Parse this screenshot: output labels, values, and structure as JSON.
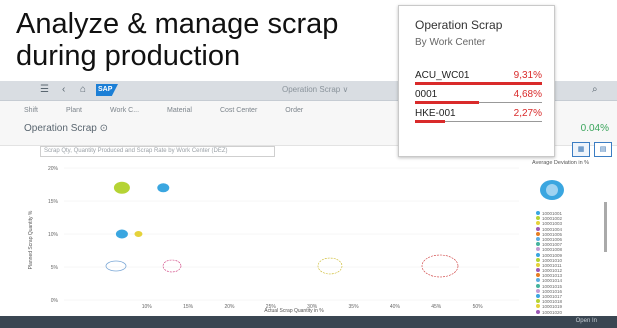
{
  "headline": {
    "line1": "Analyze & manage scrap",
    "line2": "during production"
  },
  "shellbar": {
    "title": "Operation Scrap ∨",
    "logo": "SAP"
  },
  "subheader": {
    "filters": [
      "Shift",
      "Plant",
      "Work C...",
      "Material",
      "Cost Center",
      "Order"
    ],
    "page_title": "Operation Scrap",
    "kpi": "0.04%"
  },
  "toolbar": {
    "crumb": "Scrap Qty, Quantity Produced and Scrap Rate by Work Center (DEZ)",
    "chart_btn": "▦",
    "table_btn": "▤"
  },
  "chart": {
    "y_ticks": [
      "20%",
      "15%",
      "10%",
      "5%",
      "0%"
    ],
    "x_ticks": [
      "10%",
      "15%",
      "20%",
      "25%",
      "30%",
      "35%",
      "40%",
      "45%",
      "50%"
    ],
    "ylabel": "Planned Scrap Quantity %",
    "xlabel": "Actual Scrap Quantity in %"
  },
  "chart_data": {
    "type": "scatter",
    "points": [
      {
        "x": 7,
        "y": 17,
        "color": "#b5d334"
      },
      {
        "x": 12,
        "y": 17,
        "color": "#3aa6e0"
      },
      {
        "x": 7,
        "y": 10,
        "color": "#3aa6e0"
      },
      {
        "x": 9,
        "y": 10,
        "color": "#e5d23a"
      }
    ]
  },
  "legend": {
    "title": "Average Deviation in %",
    "items": [
      "10001001",
      "10001002",
      "10001003",
      "10001004",
      "10001005",
      "10001006",
      "10001007",
      "10001008",
      "10001009",
      "10001010",
      "10001011",
      "10001012",
      "10001013",
      "10001014",
      "10001015",
      "10001016",
      "10001017",
      "10001018",
      "10001019",
      "10001020"
    ]
  },
  "footer": {
    "label": "Open In"
  },
  "card": {
    "title": "Operation Scrap",
    "subtitle": "By Work Center",
    "rows": [
      {
        "name": "ACU_WC01",
        "value": "9,31%",
        "fraction": 1.0
      },
      {
        "name": "0001",
        "value": "4,68%",
        "fraction": 0.5
      },
      {
        "name": "HKE-001",
        "value": "2,27%",
        "fraction": 0.24
      }
    ]
  },
  "colors": {
    "accent": "#d92a2a",
    "brand": "#1c7fd6",
    "positive": "#3aa55c"
  }
}
